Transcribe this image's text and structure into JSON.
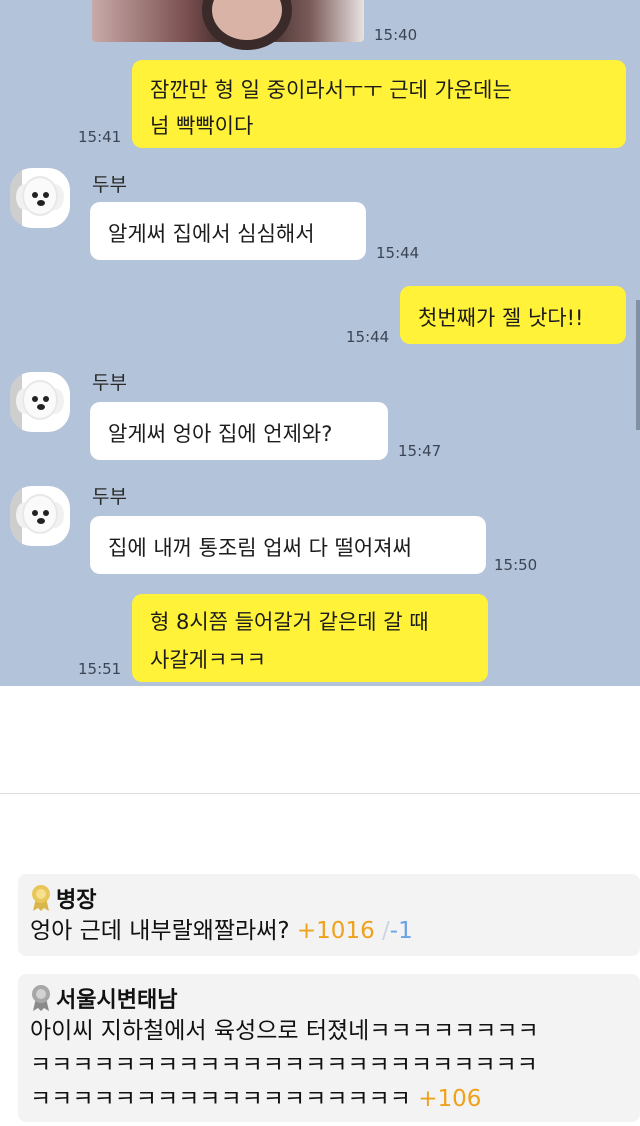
{
  "chat": {
    "messages": [
      {
        "from": "photo",
        "time": "15:40"
      },
      {
        "from": "me",
        "lines": [
          "잠깐만 형 일 중이라서ㅜㅜ 근데 가운데는",
          "넘 빡빡이다"
        ],
        "time": "15:41"
      },
      {
        "from": "them",
        "name": "두부",
        "lines": [
          "알게써 집에서 심심해서"
        ],
        "time": "15:44"
      },
      {
        "from": "me",
        "lines": [
          "첫번째가 젤 낫다!!"
        ],
        "time": "15:44"
      },
      {
        "from": "them",
        "name": "두부",
        "lines": [
          "알게써 엉아 집에 언제와?"
        ],
        "time": "15:47"
      },
      {
        "from": "them",
        "name": "두부",
        "lines": [
          "집에 내꺼 통조림 업써 다 떨어져써"
        ],
        "time": "15:50"
      },
      {
        "from": "me",
        "lines": [
          "형 8시쯤 들어갈거 같은데 갈 때",
          "사갈게ㅋㅋㅋ"
        ],
        "time": "15:51"
      }
    ]
  },
  "comments": [
    {
      "medal": "gold-medal-icon",
      "name": "병장",
      "text": "엉아 근데 내부랄왜짤라써?",
      "up": "+1016",
      "sep": "/",
      "down": "-1"
    },
    {
      "medal": "silver-medal-icon",
      "name": "서울시변태남",
      "lines": [
        "아이씨 지하철에서 육성으로 터졌네ㅋㅋㅋㅋㅋㅋㅋㅋ",
        "ㅋㅋㅋㅋㅋㅋㅋㅋㅋㅋㅋㅋㅋㅋㅋㅋㅋㅋㅋㅋㅋㅋㅋㅋ",
        "ㅋㅋㅋㅋㅋㅋㅋㅋㅋㅋㅋㅋㅋㅋㅋㅋㅋㅋ"
      ],
      "up": "+106"
    }
  ],
  "colors": {
    "bubble_me": "#fff238",
    "bubble_them": "#ffffff",
    "chat_bg": "#b3c3d9",
    "up": "#f0a11c",
    "down": "#6aa2e6"
  }
}
